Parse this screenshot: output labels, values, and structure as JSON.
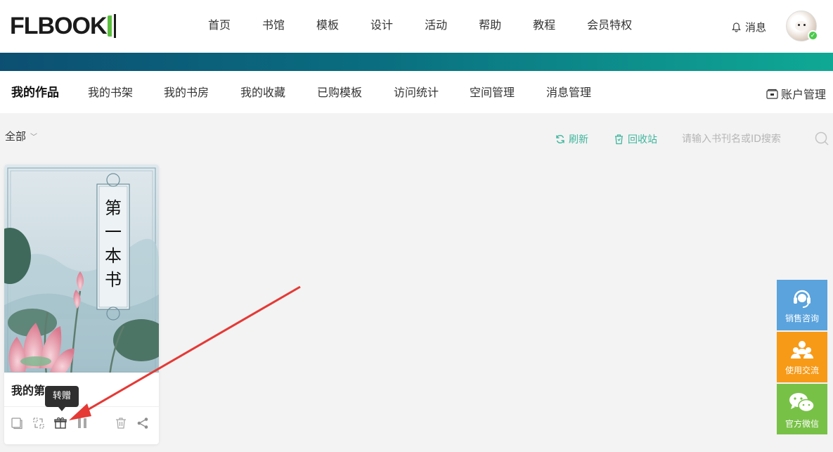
{
  "header": {
    "logo_text": "FLBOOK",
    "nav": [
      "首页",
      "书馆",
      "模板",
      "设计",
      "活动",
      "帮助",
      "教程",
      "会员特权"
    ],
    "messages_label": "消息"
  },
  "subnav": {
    "tabs": [
      "我的作品",
      "我的书架",
      "我的书房",
      "我的收藏",
      "已购模板",
      "访问统计",
      "空间管理",
      "消息管理"
    ],
    "active": "我的作品",
    "account_label": "账户管理"
  },
  "toolbar": {
    "filter_label": "全部",
    "refresh_label": "刷新",
    "recycle_label": "回收站",
    "search_placeholder": "请输入书刊名或ID搜索"
  },
  "book": {
    "title": "我的第",
    "cover_text": [
      "第",
      "一",
      "本",
      "书"
    ],
    "actions": [
      "copy-icon",
      "replace-icon",
      "gift-icon",
      "pause-icon",
      "trash-icon",
      "share-icon"
    ],
    "tooltip": "转赠"
  },
  "float_panel": {
    "items": [
      "销售咨询",
      "使用交流",
      "官方微信"
    ]
  },
  "colors": {
    "accent": "#3fb59d",
    "banner_start": "#0c4f72",
    "banner_end": "#0fa995",
    "sales": "#5aa3dd",
    "community": "#f79a17",
    "wechat": "#78c147",
    "arrow": "#e53935"
  }
}
